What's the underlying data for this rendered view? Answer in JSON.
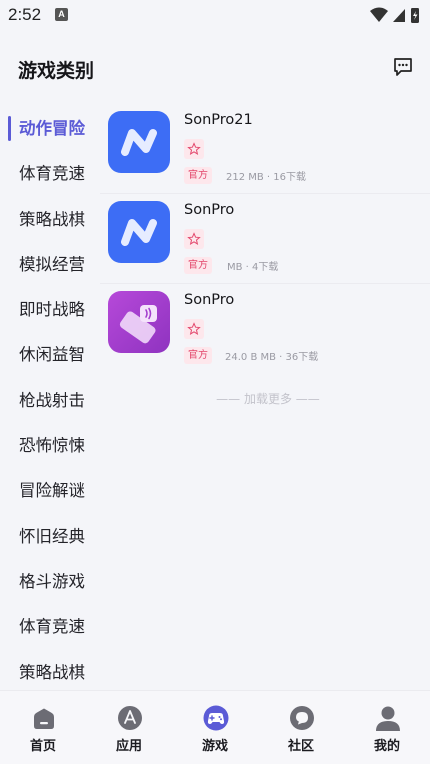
{
  "status_bar": {
    "time": "2:52",
    "notification_glyph": "A"
  },
  "header": {
    "title": "游戏类别",
    "message_icon": "chat-bubble-icon"
  },
  "sidebar": {
    "active_index": 0,
    "items": [
      {
        "label": "动作冒险"
      },
      {
        "label": "体育竞速"
      },
      {
        "label": "策略战棋"
      },
      {
        "label": "模拟经营"
      },
      {
        "label": "即时战略"
      },
      {
        "label": "休闲益智"
      },
      {
        "label": "枪战射击"
      },
      {
        "label": "恐怖惊悚"
      },
      {
        "label": "冒险解谜"
      },
      {
        "label": "怀旧经典"
      },
      {
        "label": "格斗游戏"
      },
      {
        "label": "体育竞速"
      },
      {
        "label": "策略战棋"
      }
    ]
  },
  "apps": [
    {
      "name": "SonPro21",
      "badge": "官方",
      "meta": "212 MB · 16下载",
      "icon": "n-logo-icon",
      "icon_color": "#3d6df5"
    },
    {
      "name": "SonPro",
      "badge": "官方",
      "meta": "MB · 4下载",
      "icon": "n-logo-icon",
      "icon_color": "#3d6df5"
    },
    {
      "name": "SonPro",
      "badge": "官方",
      "meta": "24.0 B MB · 36下载",
      "icon": "nfc-card-icon",
      "icon_color": "#a43fce"
    }
  ],
  "load_more": "—— 加载更多 ——",
  "tabbar": {
    "active_index": 2,
    "accent": "#5b5bd6",
    "items": [
      {
        "label": "首页",
        "icon": "home-icon"
      },
      {
        "label": "应用",
        "icon": "app-store-icon"
      },
      {
        "label": "游戏",
        "icon": "gamepad-icon"
      },
      {
        "label": "社区",
        "icon": "community-icon"
      },
      {
        "label": "我的",
        "icon": "profile-icon"
      }
    ]
  }
}
